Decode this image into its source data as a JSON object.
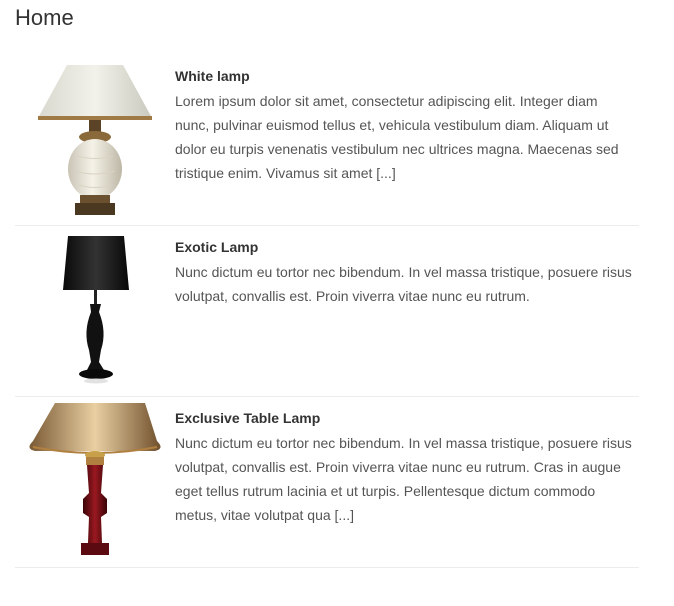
{
  "page": {
    "title": "Home"
  },
  "products": [
    {
      "name": "White lamp",
      "excerpt": "Lorem ipsum dolor sit amet, consectetur adipiscing elit. Integer diam nunc, pulvinar euismod tellus et, vehicula vestibulum diam. Aliquam ut dolor eu turpis venenatis vestibulum nec ultrices magna. Maecenas sed tristique enim. Vivamus sit amet [...]"
    },
    {
      "name": "Exotic Lamp",
      "excerpt": "Nunc dictum eu tortor nec bibendum. In vel massa tristique, posuere risus volutpat, convallis est. Proin viverra vitae nunc eu rutrum."
    },
    {
      "name": "Exclusive Table Lamp",
      "excerpt": "Nunc dictum eu tortor nec bibendum. In vel massa tristique, posuere risus volutpat, convallis est. Proin viverra vitae nunc eu rutrum. Cras in augue eget tellus rutrum lacinia et ut turpis. Pellentesque dictum commodo metus, vitae volutpat qua [...]"
    }
  ]
}
